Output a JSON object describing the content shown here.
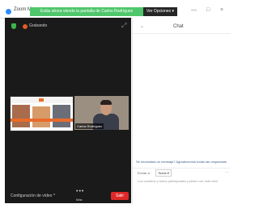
{
  "window": {
    "app_title": "Zoom M...",
    "window_controls": [
      "—",
      "□",
      "×"
    ]
  },
  "banner": {
    "text": "Estás ahora viendo la pantalla de Carlos Rodríguez",
    "stop_button": "Ver Opciones ▾"
  },
  "meeting": {
    "recording_label": "Grabando",
    "tiles": [
      {
        "name": ""
      },
      {
        "name": "Carlos Rodríguez"
      }
    ],
    "bottombar": {
      "settings_label": "Configuración de vídeo ^",
      "more_label": "Más",
      "leave_label": "Salir"
    }
  },
  "chat": {
    "title": "Chat",
    "note": "Se necesitará un mensaje? Agradecemos todas las respuestas",
    "to_label": "Enviar a:",
    "recipient": "Todos ▾",
    "input_placeholder": "Los cambios y todos participantes pueden ver este chat"
  },
  "colors": {
    "banner": "#4fc66b",
    "leave": "#e02828",
    "meeting_bg": "#1a1a1a"
  }
}
